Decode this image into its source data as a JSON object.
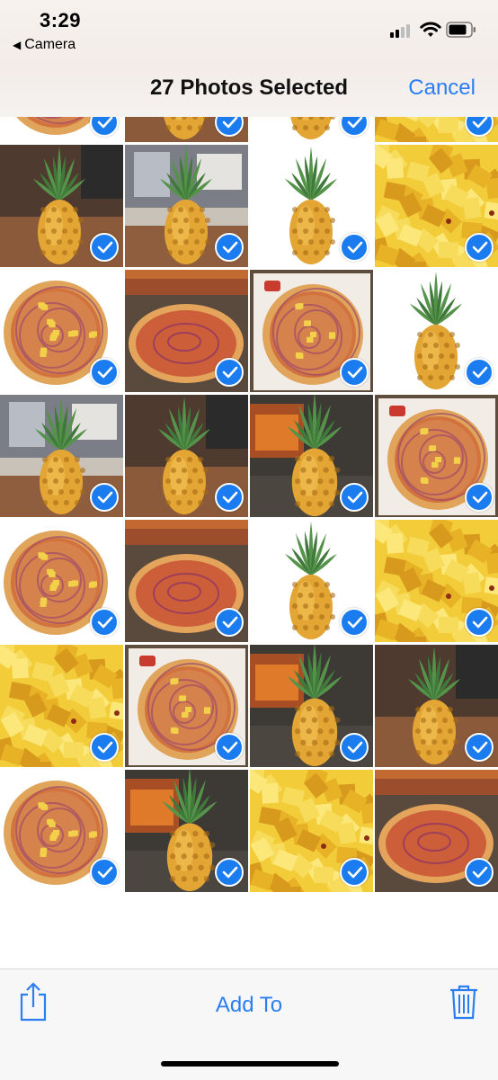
{
  "status_bar": {
    "time": "3:29",
    "back_app": "Camera"
  },
  "nav": {
    "title": "27 Photos Selected",
    "cancel": "Cancel"
  },
  "toolbar": {
    "add_to": "Add To"
  },
  "colors": {
    "accent": "#2a7ef1",
    "check": "#1b7cf0"
  },
  "icons": [
    "signal-icon",
    "wifi-icon",
    "battery-icon",
    "share-icon",
    "trash-icon",
    "checkmark-icon"
  ],
  "grid": {
    "rows": [
      [
        "pizza-white",
        "pineapple-wood",
        "pineapple-white",
        "pineapple-chunks"
      ],
      [
        "pineapple-wood",
        "pineapple-restaurant",
        "pineapple-white",
        "pineapple-chunks"
      ],
      [
        "pizza-white",
        "pizza-table",
        "pizza-paper",
        "pineapple-white"
      ],
      [
        "pineapple-restaurant",
        "pineapple-wood",
        "pineapple-dark",
        "pizza-paper"
      ],
      [
        "pizza-white",
        "pizza-table",
        "pineapple-white",
        "pineapple-chunks"
      ],
      [
        "pineapple-chunks",
        "pizza-paper",
        "pineapple-dark",
        "pineapple-wood"
      ],
      [
        "pizza-white",
        "pineapple-dark",
        "pineapple-chunks",
        "pizza-table"
      ]
    ]
  }
}
